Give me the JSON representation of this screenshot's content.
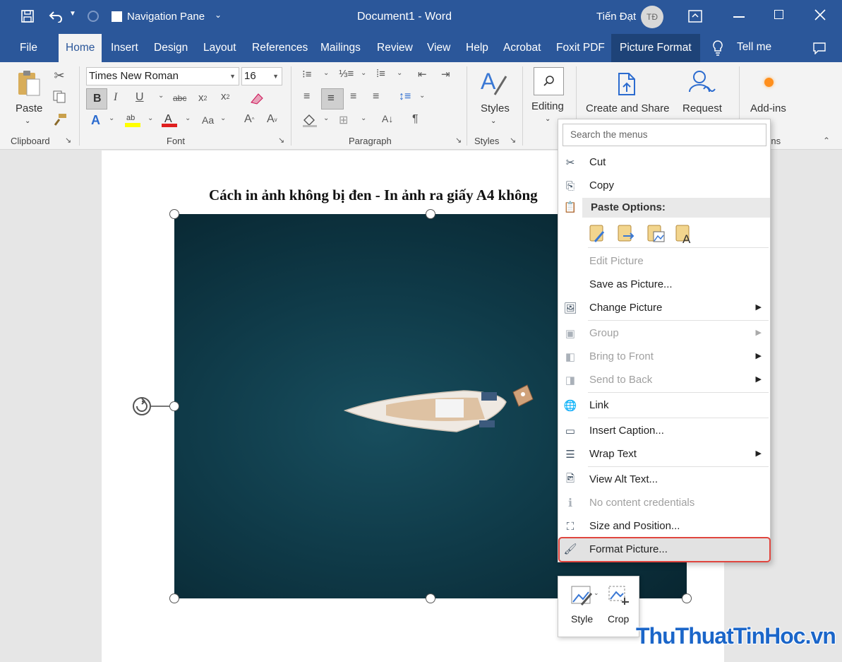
{
  "window": {
    "nav_pane_label": "Navigation Pane",
    "doc_title": "Document1  -  Word",
    "user_name": "Tiến Đạt",
    "user_initials": "TĐ"
  },
  "tabs": [
    {
      "label": "File"
    },
    {
      "label": "Home"
    },
    {
      "label": "Insert"
    },
    {
      "label": "Design"
    },
    {
      "label": "Layout"
    },
    {
      "label": "References"
    },
    {
      "label": "Mailings"
    },
    {
      "label": "Review"
    },
    {
      "label": "View"
    },
    {
      "label": "Help"
    },
    {
      "label": "Acrobat"
    },
    {
      "label": "Foxit PDF"
    },
    {
      "label": "Picture Format"
    }
  ],
  "tell_me": "Tell me",
  "ribbon": {
    "clipboard": {
      "paste": "Paste",
      "label": "Clipboard"
    },
    "font": {
      "family": "Times New Roman",
      "size": "16",
      "label": "Font"
    },
    "paragraph": {
      "label": "Paragraph"
    },
    "styles": {
      "button": "Styles",
      "label": "Styles"
    },
    "editing": {
      "button": "Editing"
    },
    "create_share": "Create and Share",
    "request": "Request",
    "addins": {
      "button": "Add-ins",
      "label": "Add-ins"
    }
  },
  "document": {
    "heading": "Cách in ảnh không bị đen - In ảnh ra giấy A4 không"
  },
  "context_menu": {
    "search_placeholder": "Search the menus",
    "items": [
      {
        "label": "Cut",
        "icon": "scissors-icon",
        "enabled": true
      },
      {
        "label": "Copy",
        "icon": "copy-icon",
        "enabled": true
      },
      {
        "label": "Paste Options:",
        "icon": "clipboard-icon",
        "enabled": true
      },
      {
        "label": "Edit Picture",
        "enabled": false
      },
      {
        "label": "Save as Picture...",
        "enabled": true
      },
      {
        "label": "Change Picture",
        "icon": "change-picture-icon",
        "enabled": true,
        "submenu": true
      },
      {
        "label": "Group",
        "icon": "group-icon",
        "enabled": false,
        "submenu": true
      },
      {
        "label": "Bring to Front",
        "icon": "bring-front-icon",
        "enabled": false,
        "submenu": true
      },
      {
        "label": "Send to Back",
        "icon": "send-back-icon",
        "enabled": false,
        "submenu": true
      },
      {
        "label": "Link",
        "icon": "link-icon",
        "enabled": true
      },
      {
        "label": "Insert Caption...",
        "icon": "caption-icon",
        "enabled": true
      },
      {
        "label": "Wrap Text",
        "icon": "wrap-text-icon",
        "enabled": true,
        "submenu": true
      },
      {
        "label": "View Alt Text...",
        "icon": "alt-text-icon",
        "enabled": true
      },
      {
        "label": "No content credentials",
        "icon": "info-icon",
        "enabled": false
      },
      {
        "label": "Size and Position...",
        "icon": "size-position-icon",
        "enabled": true
      },
      {
        "label": "Format Picture...",
        "icon": "format-picture-icon",
        "enabled": true,
        "highlighted": true
      }
    ]
  },
  "mini_toolbar": {
    "style": "Style",
    "crop": "Crop"
  },
  "watermark": "ThuThuatTinHoc.vn",
  "colors": {
    "word_blue": "#2b579a",
    "highlight_border": "#e0463f"
  }
}
